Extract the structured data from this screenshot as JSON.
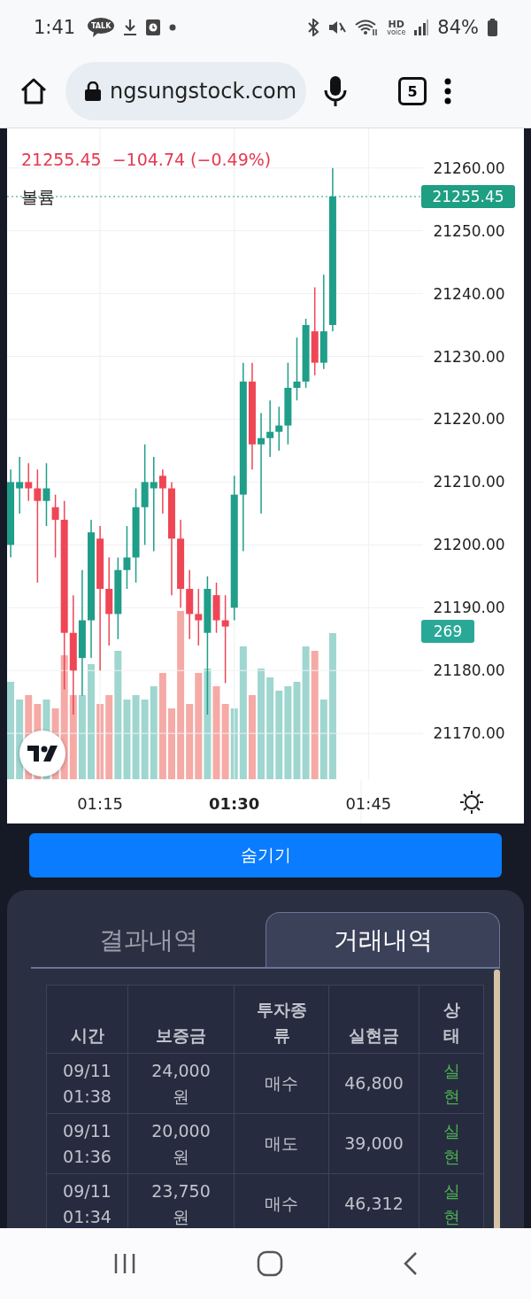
{
  "status_bar": {
    "time": "1:41",
    "talk_label": "TALK",
    "hd_label": "HD",
    "hd_sublabel": "voice",
    "battery": "84%"
  },
  "browser": {
    "url": "ngsungstock.com",
    "tab_count": "5"
  },
  "chart": {
    "last_price": "21255.45",
    "change": "−104.74 (−0.49%)",
    "legend": "볼륨",
    "chart_data": {
      "type": "candlestick",
      "x": [
        65,
        66,
        67,
        68,
        69,
        70,
        71,
        72,
        73,
        74,
        75,
        76,
        77,
        78,
        79,
        80,
        81,
        82,
        83,
        84,
        85,
        86,
        87,
        88,
        89,
        90,
        91,
        92,
        93,
        94,
        95,
        96,
        97,
        98,
        99,
        100,
        101
      ],
      "xlim": [
        64.6,
        111.1
      ],
      "ylim": [
        21162.7,
        21266.3
      ],
      "grid": true,
      "ref_lines": [
        {
          "axis": "y",
          "value": 21255.45
        }
      ],
      "xticks": [
        {
          "value": 75,
          "label": "01:15"
        },
        {
          "value": 90,
          "label": "01:30"
        },
        {
          "value": 105,
          "label": "01:45"
        }
      ],
      "ohlc": [
        [
          21200,
          21212,
          21198,
          21210
        ],
        [
          21209,
          21214,
          21205,
          21210
        ],
        [
          21210,
          21213,
          21207,
          21209
        ],
        [
          21209,
          21212,
          21194,
          21207
        ],
        [
          21207,
          21213,
          21203,
          21209
        ],
        [
          21206,
          21208,
          21198,
          21204
        ],
        [
          21204,
          21207,
          21177,
          21186
        ],
        [
          21186,
          21192,
          21173,
          21180
        ],
        [
          21182,
          21196,
          21176,
          21188
        ],
        [
          21188,
          21204,
          21182,
          21202
        ],
        [
          21201,
          21203,
          21180,
          21193
        ],
        [
          21193,
          21198,
          21184,
          21189
        ],
        [
          21189,
          21198,
          21185,
          21196
        ],
        [
          21196,
          21203,
          21193,
          21198
        ],
        [
          21198,
          21209,
          21194,
          21206
        ],
        [
          21206,
          21216,
          21200,
          21210
        ],
        [
          21209,
          21214,
          21199,
          21210
        ],
        [
          21211,
          21212,
          21205,
          21209
        ],
        [
          21209,
          21210,
          21192,
          21201
        ],
        [
          21201,
          21204,
          21190,
          21193
        ],
        [
          21193,
          21196,
          21185,
          21189
        ],
        [
          21189,
          21193,
          21184,
          21188
        ],
        [
          21186,
          21195,
          21173,
          21193
        ],
        [
          21192,
          21194,
          21186,
          21188
        ],
        [
          21188,
          21192,
          21178,
          21187
        ],
        [
          21190,
          21211,
          21188,
          21208
        ],
        [
          21208,
          21229,
          21199,
          21226
        ],
        [
          21226,
          21229,
          21212,
          21216
        ],
        [
          21216,
          21221,
          21205,
          21217
        ],
        [
          21217,
          21223,
          21214,
          21218
        ],
        [
          21218,
          21222,
          21215,
          21219
        ],
        [
          21219,
          21229,
          21216,
          21225
        ],
        [
          21225,
          21233,
          21223,
          21226
        ],
        [
          21226,
          21236,
          21225,
          21235
        ],
        [
          21234,
          21241,
          21227,
          21229
        ],
        [
          21229,
          21243,
          21228,
          21234
        ],
        [
          21235,
          21260,
          21234,
          21255.45
        ]
      ],
      "yticks": [
        {
          "value": 21260,
          "label": "21260.00"
        },
        {
          "value": 21250,
          "label": "21250.00"
        },
        {
          "value": 21240,
          "label": "21240.00"
        },
        {
          "value": 21230,
          "label": "21230.00"
        },
        {
          "value": 21220,
          "label": "21220.00"
        },
        {
          "value": 21210,
          "label": "21210.00"
        },
        {
          "value": 21200,
          "label": "21200.00"
        },
        {
          "value": 21190,
          "label": "21190.00"
        },
        {
          "value": 21180,
          "label": "21180.00"
        },
        {
          "value": 21170,
          "label": "21170.00"
        }
      ]
    },
    "price_tag": "21255.45",
    "volume_tag": "269",
    "time_axis": [
      {
        "emphasized": false
      },
      {
        "emphasized": true
      },
      {
        "emphasized": false
      }
    ]
  },
  "hide_button": "숨기기",
  "tabs": [
    {
      "label": "결과내역",
      "selected": false
    },
    {
      "label": "거래내역",
      "selected": true
    }
  ],
  "table": {
    "columns": [
      "시간",
      "보증금",
      "투자종류",
      "실현금",
      "상태"
    ],
    "rows": [
      [
        "09/11 01:38",
        "24,000원",
        "매수",
        "46,800",
        "실현"
      ],
      [
        "09/11 01:36",
        "20,000원",
        "매도",
        "39,000",
        "실현"
      ],
      [
        "09/11 01:34",
        "23,750원",
        "매수",
        "46,312",
        "실현"
      ]
    ]
  }
}
